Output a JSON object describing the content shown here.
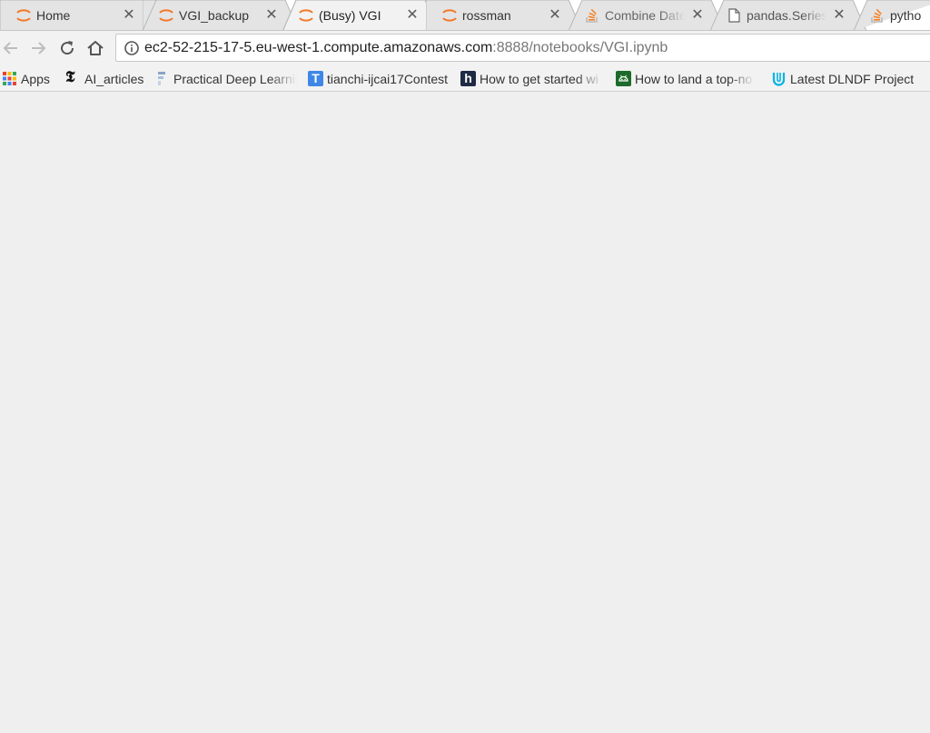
{
  "tabs": [
    {
      "title": "Home",
      "icon": "jupyter-icon"
    },
    {
      "title": "VGI_backup",
      "icon": "jupyter-icon"
    },
    {
      "title": "(Busy) VGI",
      "icon": "jupyter-icon",
      "active": true
    },
    {
      "title": "rossman",
      "icon": "jupyter-icon"
    },
    {
      "title": "Combine Date",
      "icon": "stackoverflow-icon"
    },
    {
      "title": "pandas.Series.",
      "icon": "document-icon"
    },
    {
      "title": "pytho",
      "icon": "stackoverflow-icon"
    }
  ],
  "address_bar": {
    "host": "ec2-52-215-17-5.eu-west-1.compute.amazonaws.com",
    "rest": ":8888/notebooks/VGI.ipynb"
  },
  "bookmarks": [
    {
      "label": "Apps",
      "icon": "apps-grid-icon"
    },
    {
      "label": "AI_articles",
      "icon": "nytimes-icon"
    },
    {
      "label": "Practical Deep Learnin",
      "icon": "fastai-icon"
    },
    {
      "label": "tianchi-ijcai17Contest",
      "icon": "tianchi-icon"
    },
    {
      "label": "How to get started wi",
      "icon": "hashnode-icon"
    },
    {
      "label": "How to land a top-no",
      "icon": "android-icon"
    },
    {
      "label": "Latest DLNDF Project",
      "icon": "udacity-icon"
    }
  ],
  "colors": {
    "jupyter_orange": "#f37726",
    "stackoverflow_orange": "#f48024",
    "content_bg": "#efefef"
  }
}
